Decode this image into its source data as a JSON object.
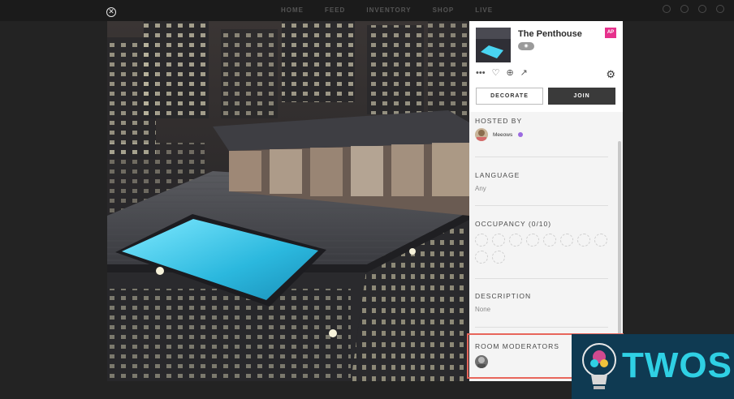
{
  "nav": {
    "links": [
      "HOME",
      "FEED",
      "INVENTORY",
      "SHOP",
      "LIVE"
    ]
  },
  "room": {
    "title": "The Penthouse",
    "badge": "AP",
    "views_icon": "eye-icon"
  },
  "actions": {
    "more": "•••",
    "like": "♡",
    "add": "⊕",
    "share": "↗",
    "settings": "⚙",
    "decorate_label": "DECORATE",
    "join_label": "JOIN"
  },
  "sections": {
    "hosted_by": {
      "heading": "HOSTED BY",
      "host_name": "Meeows"
    },
    "language": {
      "heading": "LANGUAGE",
      "value": "Any"
    },
    "occupancy": {
      "heading": "OCCUPANCY (0/10)",
      "slots": 10
    },
    "description": {
      "heading": "DESCRIPTION",
      "value": "None"
    },
    "room_moderators": {
      "heading": "ROOM MODERATORS"
    }
  },
  "watermark": {
    "text": "TWOS"
  },
  "colors": {
    "accent": "#e6318c",
    "join": "#3a3a3a",
    "highlight": "#e8665b",
    "watermark_bg": "#0f3a52",
    "watermark_text": "#2fd0e4"
  }
}
